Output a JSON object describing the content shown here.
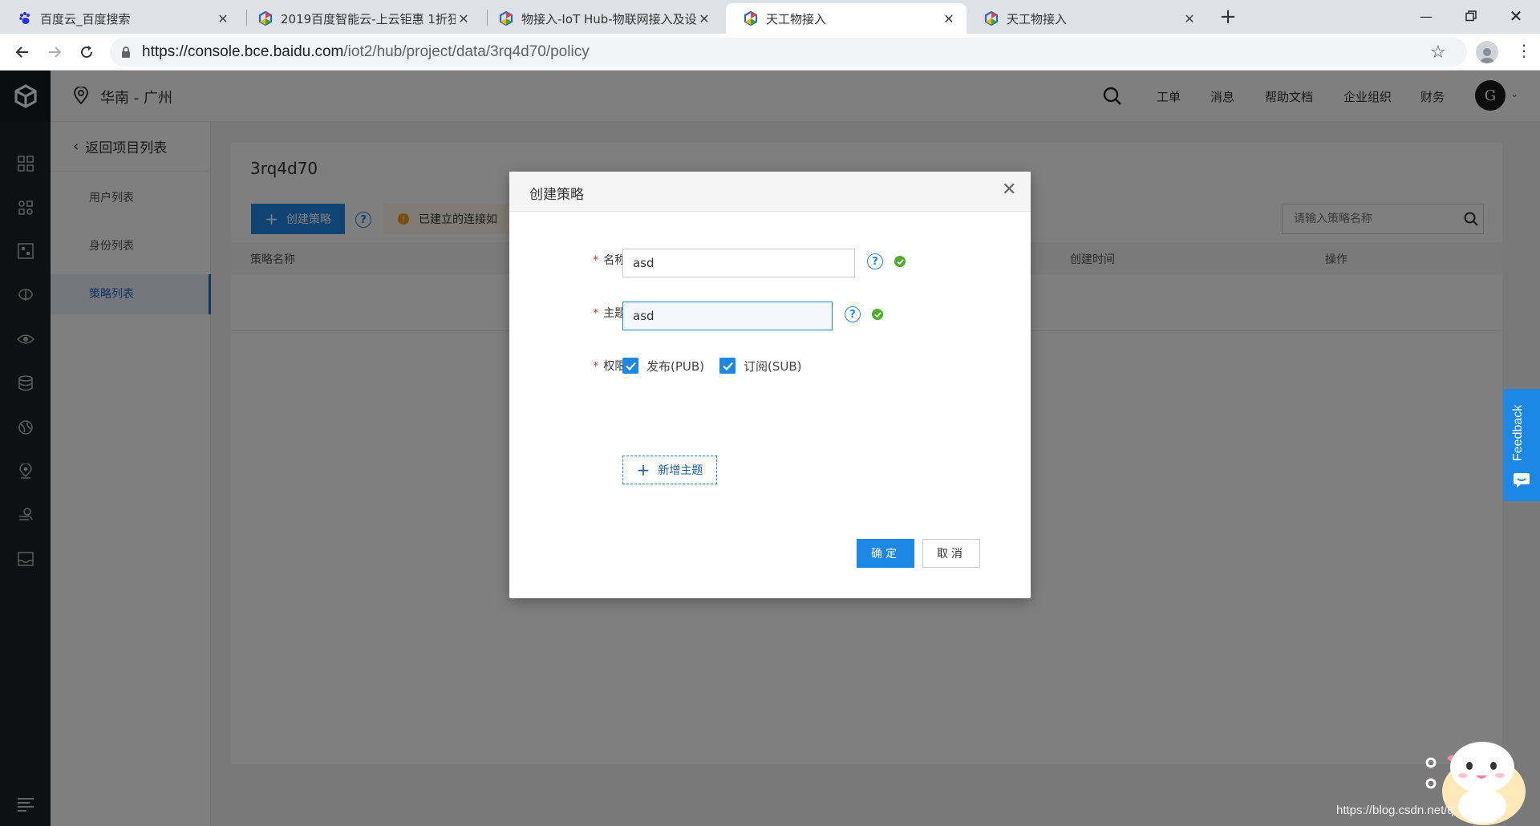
{
  "browser": {
    "tabs": [
      {
        "title": "百度云_百度搜索",
        "icon": "baidu-paw-icon",
        "active": false
      },
      {
        "title": "2019百度智能云-上云钜惠 1折狂",
        "icon": "bce-cube-icon",
        "active": false
      },
      {
        "title": "物接入-IoT Hub-物联网接入及设",
        "icon": "bce-cube-icon",
        "active": false
      },
      {
        "title": "天工物接入",
        "icon": "bce-cube-icon",
        "active": true
      },
      {
        "title": "天工物接入",
        "icon": "bce-cube-icon",
        "active": false
      }
    ],
    "url_host": "https://console.bce.baidu.com",
    "url_path": "/iot2/hub/project/data/3rq4d70/policy"
  },
  "header": {
    "region": "华南 - 广州",
    "nav": [
      "工单",
      "消息",
      "帮助文档",
      "企业组织",
      "财务"
    ],
    "avatar_letter": "G"
  },
  "sidebar": {
    "back_label": "返回项目列表",
    "items": [
      {
        "label": "用户列表",
        "active": false
      },
      {
        "label": "身份列表",
        "active": false
      },
      {
        "label": "策略列表",
        "active": true
      }
    ]
  },
  "main": {
    "project_title": "3rq4d70",
    "create_button": "创建策略",
    "notice": "已建立的连接如",
    "search_placeholder": "请输入策略名称",
    "columns": [
      "策略名称",
      "创建时间",
      "操作"
    ]
  },
  "modal": {
    "title": "创建策略",
    "name_label": "名称:",
    "name_value": "asd",
    "topic_label": "主题:",
    "topic_value": "asd",
    "permission_label": "权限:",
    "pub_label": "发布(PUB)",
    "pub_checked": true,
    "sub_label": "订阅(SUB)",
    "sub_checked": true,
    "add_topic_label": "新增主题",
    "ok_label": "确定",
    "cancel_label": "取消"
  },
  "feedback_label": "Feedback",
  "watermark": "https://blog.csdn.net/q",
  "colors": {
    "primary": "#1c87e5",
    "sidebar_bg": "#1f2126",
    "required": "#e0312b",
    "success": "#4caf2a"
  }
}
